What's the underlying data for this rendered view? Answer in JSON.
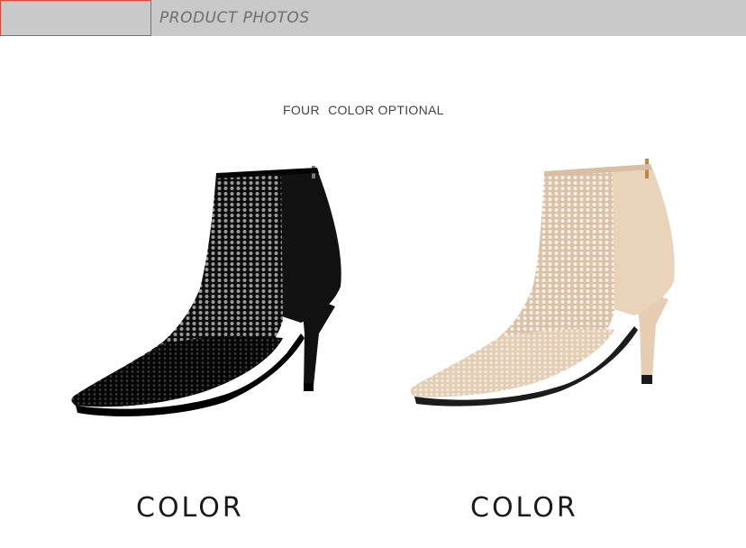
{
  "header": {
    "title": "PRODUCT PHOTOS",
    "accent_color": "#e0473a",
    "bar_color": "#c9c9c9"
  },
  "subtitle": {
    "word1": "FOUR",
    "rest": "COLOR OPTIONAL"
  },
  "products": [
    {
      "image": "black-mesh-ankle-boot",
      "color": "#111111",
      "label": "COLOR"
    },
    {
      "image": "beige-mesh-ankle-boot",
      "color": "#e8d2bb",
      "label": "COLOR"
    }
  ]
}
